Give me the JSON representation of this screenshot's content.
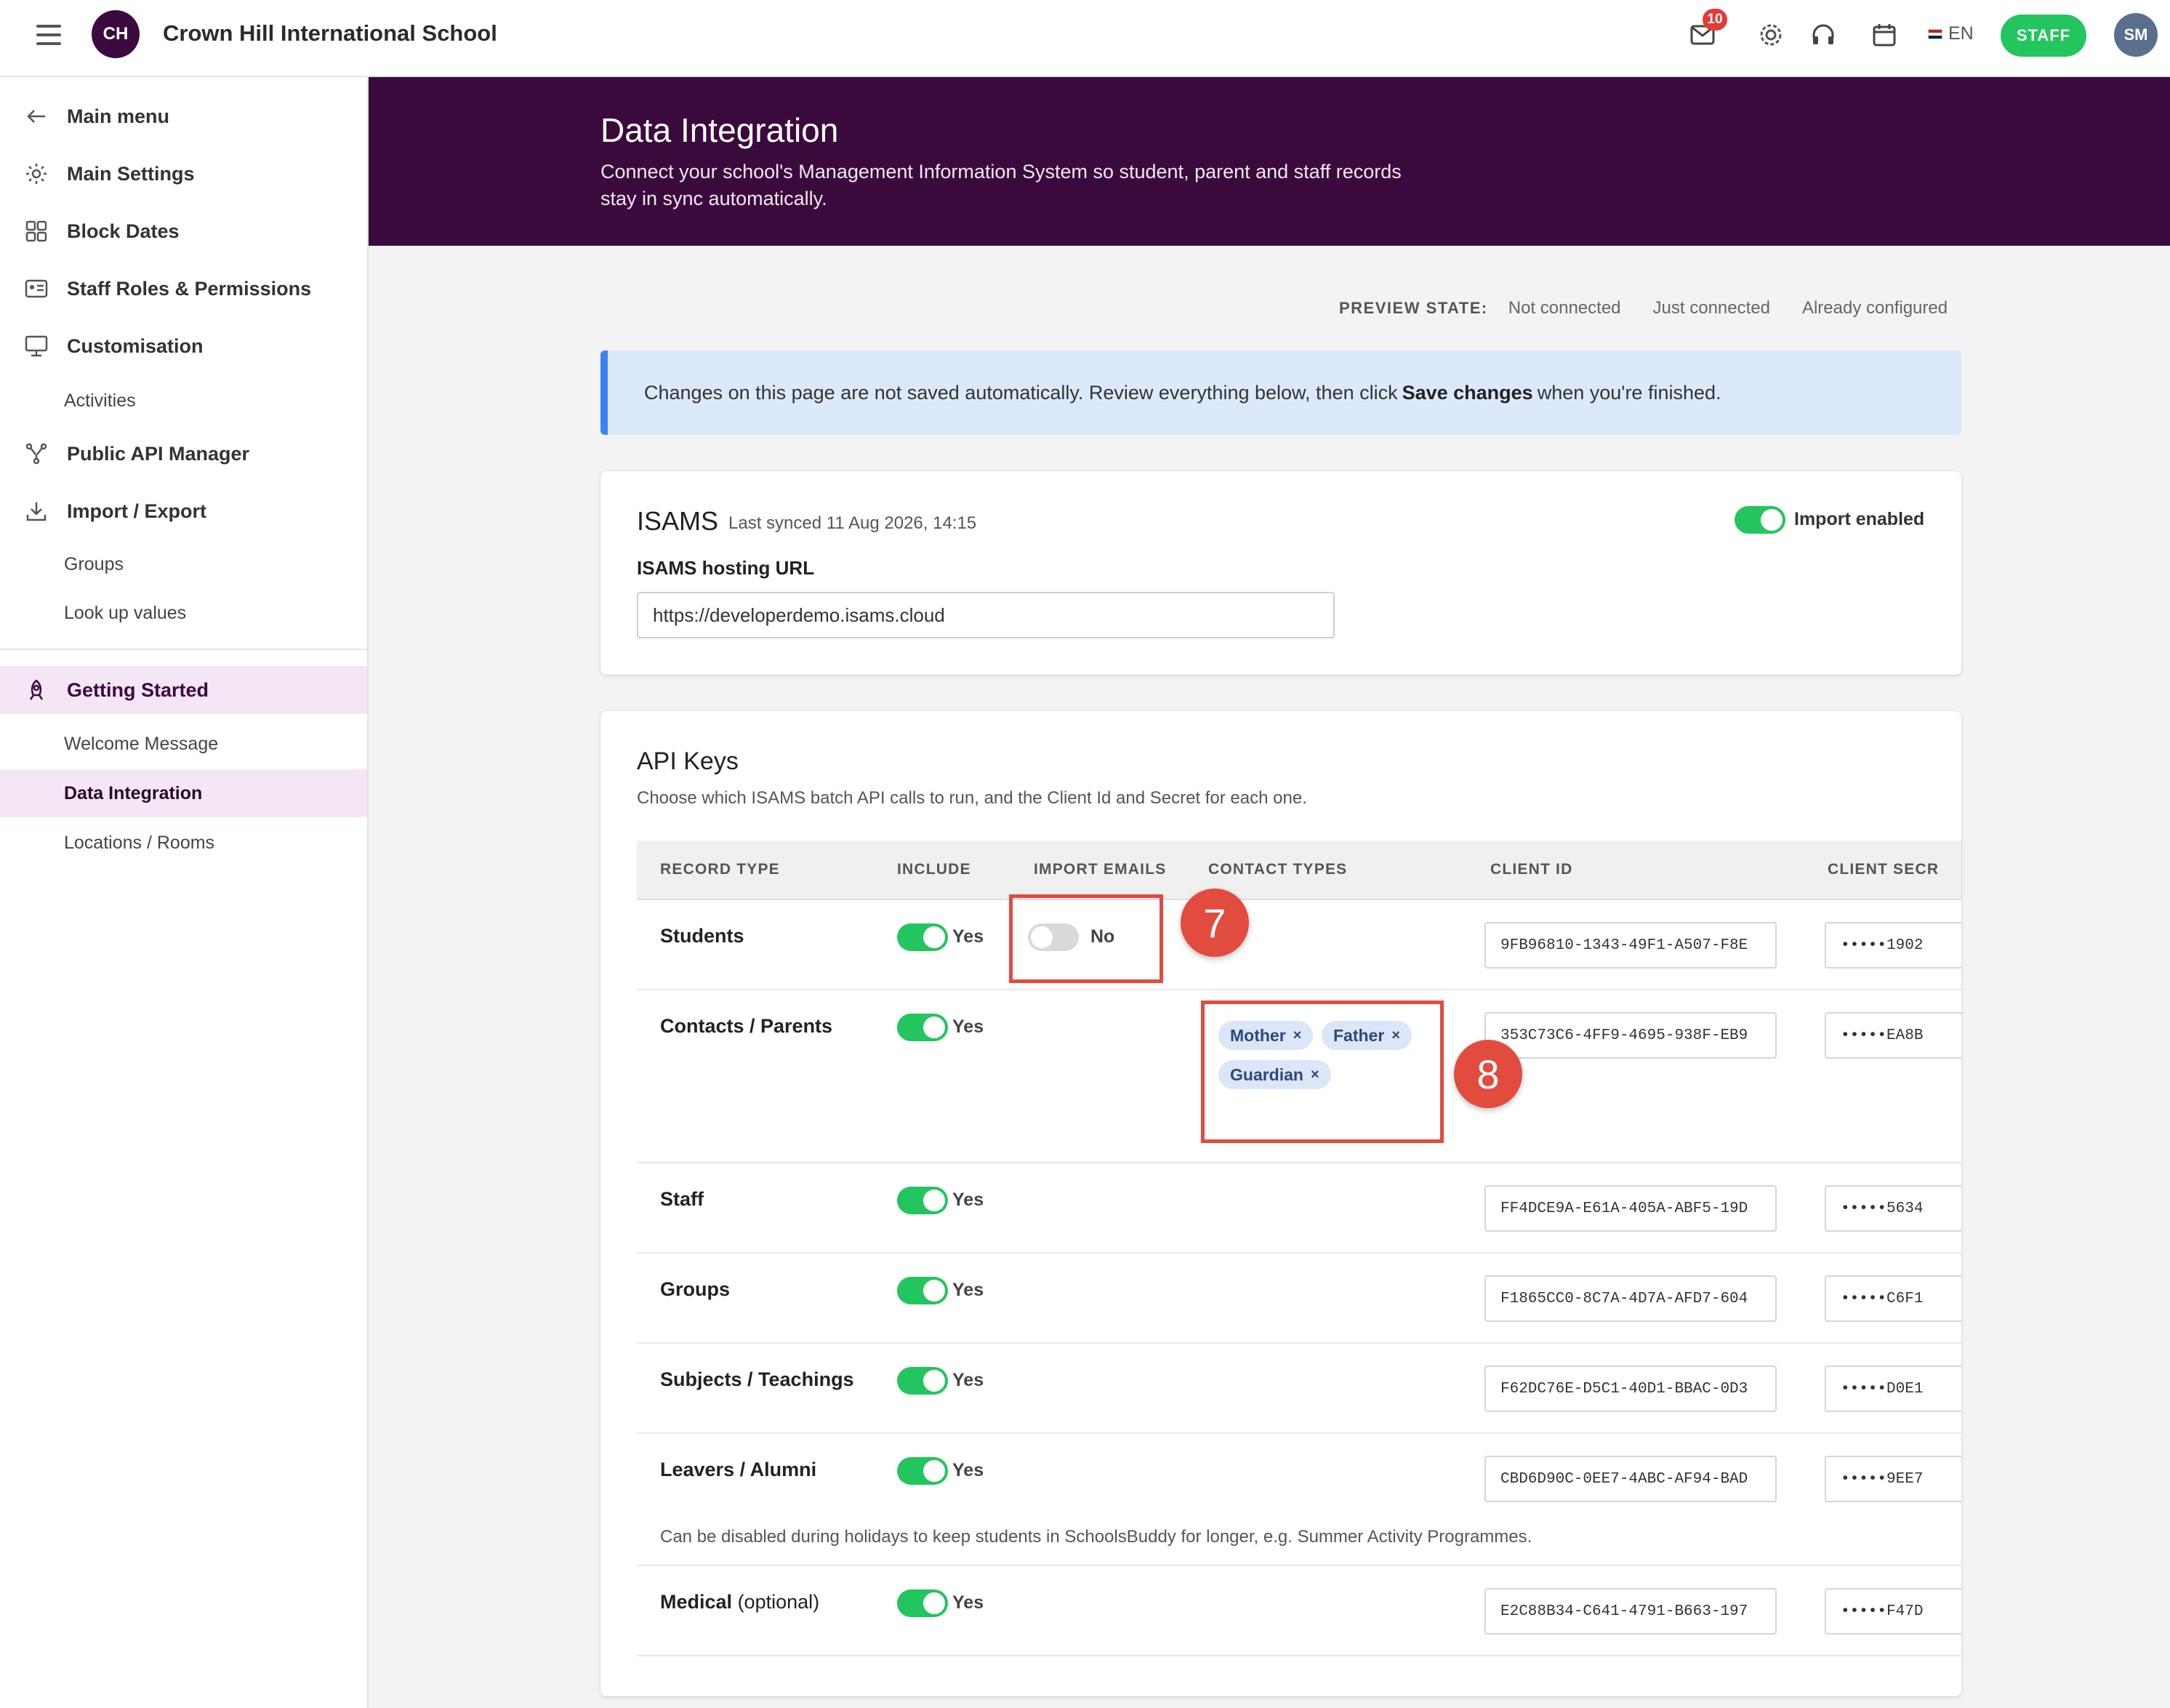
{
  "topbar": {
    "logo_initials": "CH",
    "school_name": "Crown Hill International School",
    "mail_badge": "10",
    "language": "EN",
    "staff_label": "STAFF",
    "user_initials": "SM"
  },
  "sidebar": {
    "main_menu": "Main menu",
    "main_settings": "Main Settings",
    "block_dates": "Block Dates",
    "staff_roles": "Staff Roles & Permissions",
    "customisation": "Customisation",
    "activities": "Activities",
    "public_api": "Public API Manager",
    "import_export": "Import / Export",
    "groups": "Groups",
    "lookup_values": "Look up values",
    "getting_started": "Getting Started",
    "welcome_message": "Welcome Message",
    "data_integration": "Data Integration",
    "locations_rooms": "Locations / Rooms"
  },
  "hero": {
    "title": "Data Integration",
    "subtitle": "Connect your school's Management Information System so student, parent and staff records stay in sync automatically."
  },
  "preview_state": {
    "label": "PREVIEW STATE:",
    "options": [
      "Not connected",
      "Just connected",
      "Already configured"
    ]
  },
  "banner": {
    "before": "Changes on this page are not saved automatically. Review everything below, then click",
    "bold": "Save changes",
    "after": "when you're finished."
  },
  "isams": {
    "title": "ISAMS",
    "last_synced": "Last synced 11 Aug 2026, 14:15",
    "import_label": "Import enabled",
    "url_label": "ISAMS hosting URL",
    "url_value": "https://developerdemo.isams.cloud"
  },
  "api_keys": {
    "title": "API Keys",
    "description": "Choose which ISAMS batch API calls to run, and the Client Id and Secret for each one.",
    "headers": {
      "record_type": "RECORD TYPE",
      "include": "INCLUDE",
      "import_emails": "IMPORT EMAILS",
      "contact_types": "CONTACT TYPES",
      "client_id": "CLIENT ID",
      "client_secret": "CLIENT SECR"
    },
    "rows": [
      {
        "name": "Students",
        "include": "Yes",
        "import_emails": "No",
        "client_id": "9FB96810-1343-49F1-A507-F8E",
        "secret": "•••••1902"
      },
      {
        "name": "Contacts / Parents",
        "include": "Yes",
        "client_id": "353C73C6-4FF9-4695-938F-EB9",
        "secret": "•••••EA8B"
      },
      {
        "name": "Staff",
        "include": "Yes",
        "client_id": "FF4DCE9A-E61A-405A-ABF5-19D",
        "secret": "•••••5634"
      },
      {
        "name": "Groups",
        "include": "Yes",
        "client_id": "F1865CC0-8C7A-4D7A-AFD7-604",
        "secret": "•••••C6F1"
      },
      {
        "name": "Subjects / Teachings",
        "include": "Yes",
        "client_id": "F62DC76E-D5C1-40D1-BBAC-0D3",
        "secret": "•••••D0E1"
      },
      {
        "name": "Leavers / Alumni",
        "include": "Yes",
        "client_id": "CBD6D90C-0EE7-4ABC-AF94-BAD",
        "secret": "•••••9EE7"
      },
      {
        "name": "Medical",
        "name_suffix": "(optional)",
        "include": "Yes",
        "client_id": "E2C88B34-C641-4791-B663-197",
        "secret": "•••••F47D"
      }
    ],
    "contact_types": [
      "Mother",
      "Father",
      "Guardian"
    ],
    "chip_remove": "×",
    "leavers_note": "Can be disabled during holidays to keep students in SchoolsBuddy for longer, e.g. Summer Activity Programmes."
  },
  "annotations": {
    "marker_7": "7",
    "marker_8": "8"
  },
  "colors": {
    "brand": "#3b0a3c",
    "accent_green": "#22c55e",
    "info_bg": "#dce9fb",
    "info_border": "#3b82f6",
    "highlight": "#e14c3f"
  }
}
